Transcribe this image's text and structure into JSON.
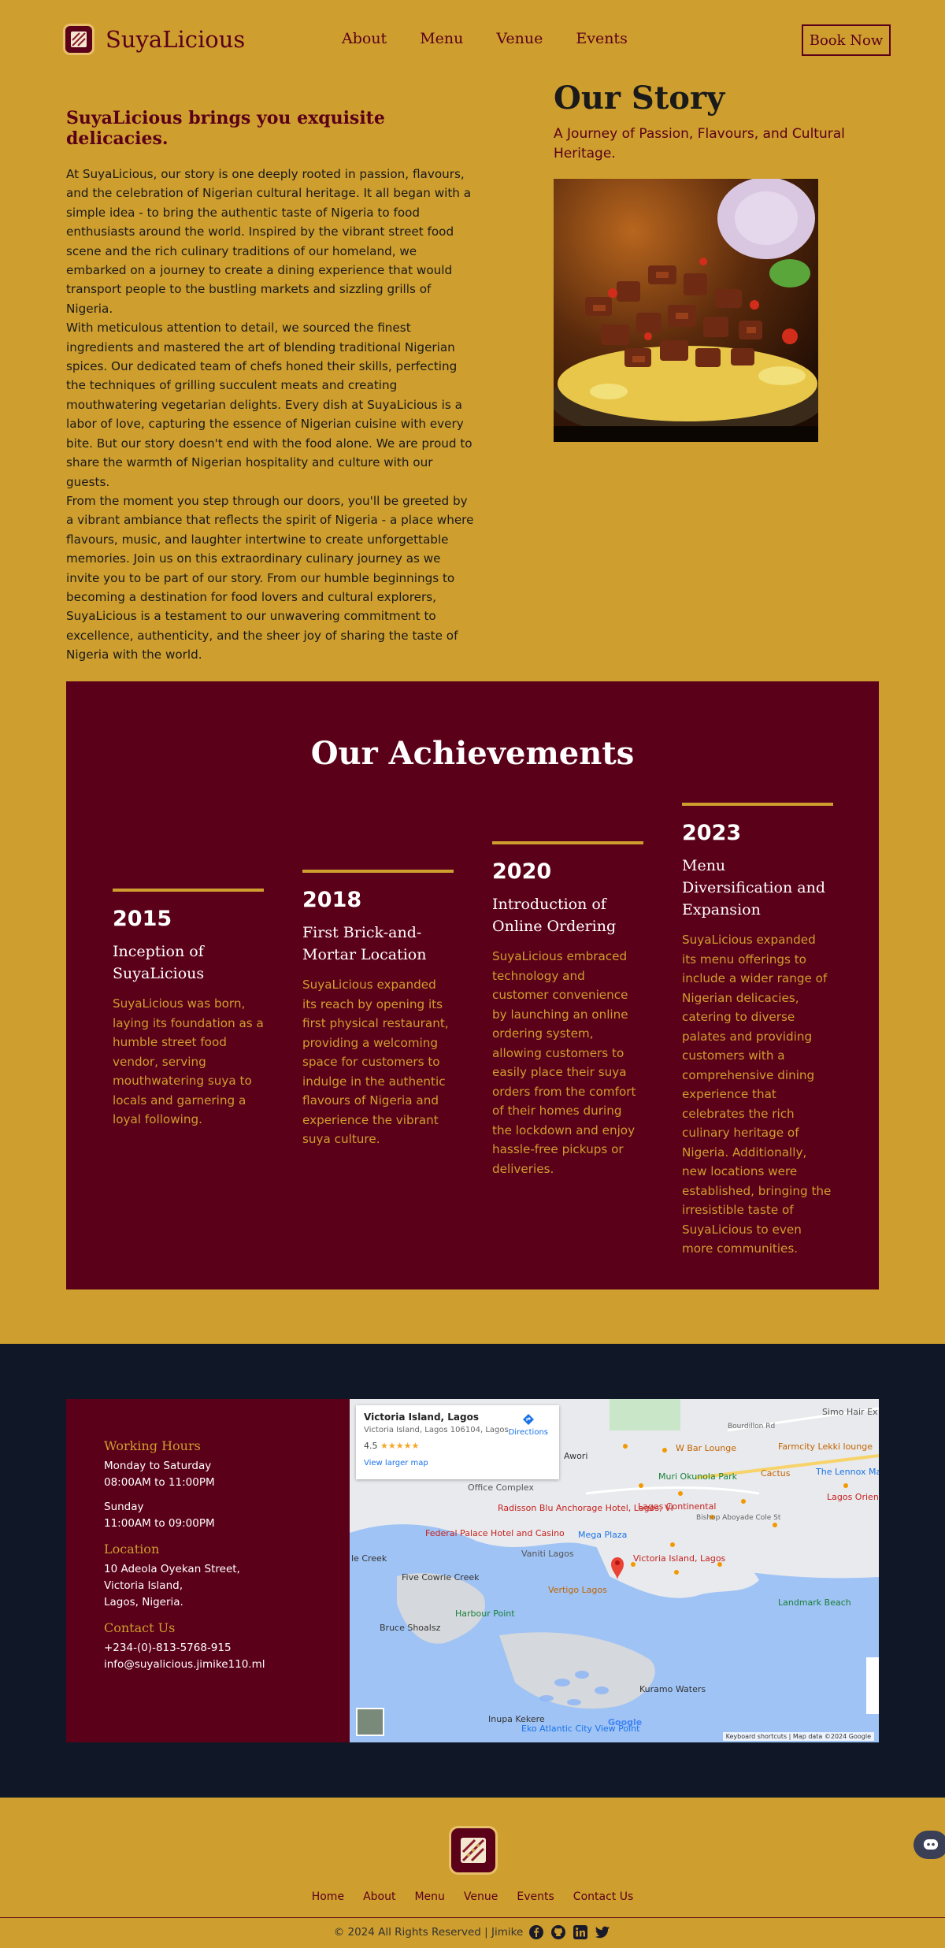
{
  "nav": {
    "brand": "SuyaLicious",
    "links": [
      "About",
      "Menu",
      "Venue",
      "Events"
    ],
    "cta": "Book Now"
  },
  "story": {
    "tagline": "SuyaLicious brings you exquisite delicacies.",
    "title": "Our Story",
    "subtitle": "A Journey of Passion, Flavours, and Cultural Heritage.",
    "paragraphs": [
      "At SuyaLicious, our story is one deeply rooted in passion, flavours, and the celebration of Nigerian cultural heritage. It all began with a simple idea - to bring the authentic taste of Nigeria to food enthusiasts around the world. Inspired by the vibrant street food scene and the rich culinary traditions of our homeland, we embarked on a journey to create a dining experience that would transport people to the bustling markets and sizzling grills of Nigeria.",
      "With meticulous attention to detail, we sourced the finest ingredients and mastered the art of blending traditional Nigerian spices. Our dedicated team of chefs honed their skills, perfecting the techniques of grilling succulent meats and creating mouthwatering vegetarian delights. Every dish at SuyaLicious is a labor of love, capturing the essence of Nigerian cuisine with every bite. But our story doesn't end with the food alone. We are proud to share the warmth of Nigerian hospitality and culture with our guests.",
      "From the moment you step through our doors, you'll be greeted by a vibrant ambiance that reflects the spirit of Nigeria - a place where flavours, music, and laughter intertwine to create unforgettable memories. Join us on this extraordinary culinary journey as we invite you to be part of our story. From our humble beginnings to becoming a destination for food lovers and cultural explorers, SuyaLicious is a testament to our unwavering commitment to excellence, authenticity, and the sheer joy of sharing the taste of Nigeria with the world."
    ]
  },
  "achievements": {
    "title": "Our Achievements",
    "items": [
      {
        "year": "2015",
        "heading": "Inception of SuyaLicious",
        "text": "SuyaLicious was born, laying its foundation as a humble street food vendor, serving mouthwatering suya to locals and garnering a loyal following."
      },
      {
        "year": "2018",
        "heading": "First Brick-and-Mortar Location",
        "text": "SuyaLicious expanded its reach by opening its first physical restaurant, providing a welcoming space for customers to indulge in the authentic flavours of Nigeria and experience the vibrant suya culture."
      },
      {
        "year": "2020",
        "heading": "Introduction of Online Ordering",
        "text": "SuyaLicious embraced technology and customer convenience by launching an online ordering system, allowing customers to easily place their suya orders from the comfort of their homes during the lockdown and enjoy hassle-free pickups or deliveries."
      },
      {
        "year": "2023",
        "heading": "Menu Diversification and Expansion",
        "text": "SuyaLicious expanded its menu offerings to include a wider range of Nigerian delicacies, catering to diverse palates and providing customers with a comprehensive dining experience that celebrates the rich culinary heritage of Nigeria. Additionally, new locations were established, bringing the irresistible taste of SuyaLicious to even more communities."
      }
    ]
  },
  "contact": {
    "hours_title": "Working Hours",
    "hours": [
      {
        "days": "Monday to Saturday",
        "time": "08:00AM to 11:00PM"
      },
      {
        "days": "Sunday",
        "time": "11:00AM to 09:00PM"
      }
    ],
    "location_title": "Location",
    "address": [
      "10 Adeola Oyekan Street,",
      "Victoria Island,",
      "Lagos, Nigeria."
    ],
    "contact_title": "Contact Us",
    "phone": "+234-(0)-813-5768-915",
    "email": "info@suyalicious.jimike110.ml"
  },
  "map": {
    "place": "Victoria Island, Lagos",
    "address": "Victoria Island, Lagos 106104, Lagos",
    "rating": "4.5",
    "stars": "★★★★★",
    "directions": "Directions",
    "larger_map": "View larger map",
    "footer": "Keyboard shortcuts  |  Map data ©2024 Google",
    "labels": [
      "Awori",
      "W Bar Lounge",
      "Farmcity Lekki lounge",
      "Muri Okunola Park",
      "Radisson Blu Anchorage Hotel, Lagos, VI",
      "Lagos Continental",
      "Federal Palace Hotel and Casino",
      "Mega Plaza",
      "Vaniti Lagos",
      "Victoria Island, Lagos",
      "Vertigo Lagos",
      "Five Cowrie Creek",
      "Harbour Point",
      "Bruce Shoalsz",
      "Landmark Beach",
      "Kuramo Waters",
      "Inupa Kekere",
      "Eko Atlantic City View Point",
      "Simo Hair Ex",
      "The Lennox Ma",
      "Lagos Oriental",
      "Office Complex",
      "Bishop Aboyade Cole St",
      "Bourdillon Rd",
      "Cactus",
      "le Creek",
      "Google"
    ]
  },
  "footer": {
    "links": [
      "Home",
      "About",
      "Menu",
      "Venue",
      "Events",
      "Contact Us"
    ],
    "copyright": "© 2024 All Rights Reserved | Jimike"
  },
  "colors": {
    "gold": "#CE9E2E",
    "maroon": "#5B0019",
    "navy": "#101828"
  }
}
